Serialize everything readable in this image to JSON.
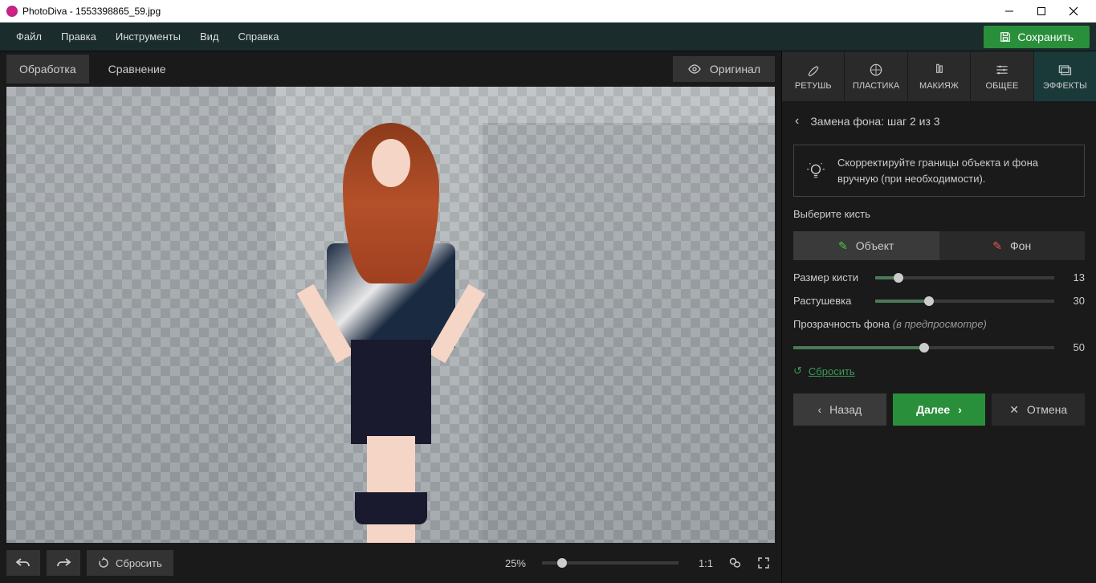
{
  "titlebar": {
    "title": "PhotoDiva - 1553398865_59.jpg"
  },
  "menu": {
    "file": "Файл",
    "edit": "Правка",
    "tools": "Инструменты",
    "view": "Вид",
    "help": "Справка",
    "save": "Сохранить"
  },
  "lefttabs": {
    "process": "Обработка",
    "compare": "Сравнение",
    "original": "Оригинал"
  },
  "bottombar": {
    "reset": "Сбросить",
    "zoom": "25%",
    "fit": "1:1"
  },
  "toptabs": {
    "retouch": "РЕТУШЬ",
    "plastic": "ПЛАСТИКА",
    "makeup": "МАКИЯЖ",
    "general": "ОБЩЕЕ",
    "effects": "ЭФФЕКТЫ"
  },
  "step": {
    "title": "Замена фона: шаг 2 из 3"
  },
  "hint": "Скорректируйте границы объекта и фона вручную (при необходимости).",
  "brush": {
    "title": "Выберите кисть",
    "object": "Объект",
    "background": "Фон"
  },
  "sliders": {
    "size_label": "Размер кисти",
    "size_val": "13",
    "feather_label": "Растушевка",
    "feather_val": "30",
    "opacity_label": "Прозрачность фона",
    "opacity_hint": "(в предпросмотре)",
    "opacity_val": "50"
  },
  "resetlink": "Сбросить",
  "nav": {
    "back": "Назад",
    "next": "Далее",
    "cancel": "Отмена"
  }
}
